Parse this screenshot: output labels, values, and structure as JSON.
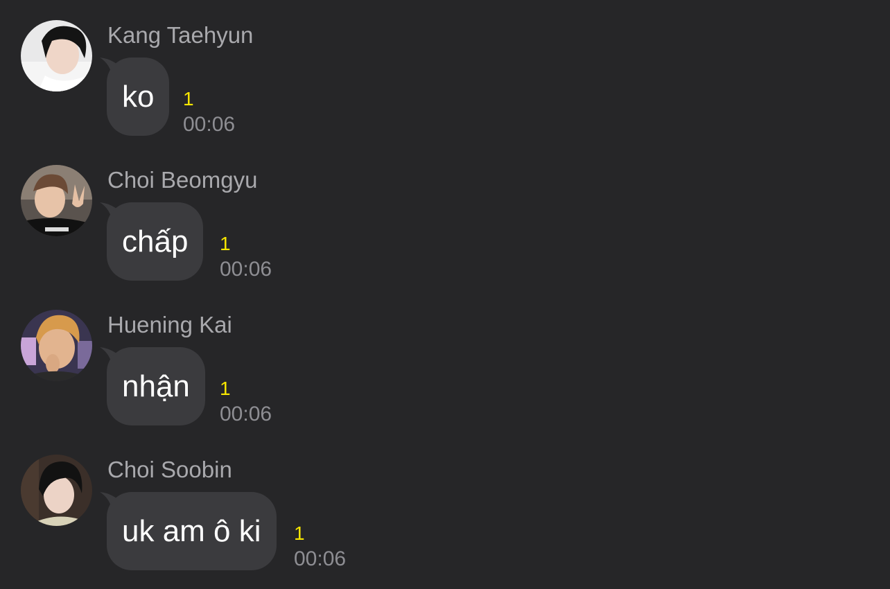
{
  "chat": {
    "messages": [
      {
        "sender": "Kang Taehyun",
        "text": "ko",
        "unread": "1",
        "time": "00:06",
        "avatar_icon": "profile-photo-icon"
      },
      {
        "sender": "Choi Beomgyu",
        "text": "chấp",
        "unread": "1",
        "time": "00:06",
        "avatar_icon": "profile-photo-icon"
      },
      {
        "sender": "Huening Kai",
        "text": "nhận",
        "unread": "1",
        "time": "00:06",
        "avatar_icon": "profile-photo-icon"
      },
      {
        "sender": "Choi Soobin",
        "text": "uk am ô ki",
        "unread": "1",
        "time": "00:06",
        "avatar_icon": "profile-photo-icon"
      }
    ]
  },
  "colors": {
    "background": "#262628",
    "bubble": "#3b3b3e",
    "unread": "#f7e600",
    "sender_name": "#a9a9ad",
    "timestamp": "#8e8e93"
  }
}
